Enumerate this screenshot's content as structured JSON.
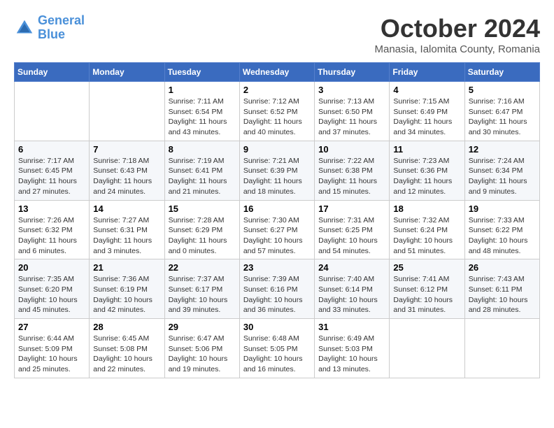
{
  "logo": {
    "line1": "General",
    "line2": "Blue"
  },
  "title": "October 2024",
  "location": "Manasia, Ialomita County, Romania",
  "weekdays": [
    "Sunday",
    "Monday",
    "Tuesday",
    "Wednesday",
    "Thursday",
    "Friday",
    "Saturday"
  ],
  "weeks": [
    [
      {
        "day": "",
        "sunrise": "",
        "sunset": "",
        "daylight": ""
      },
      {
        "day": "",
        "sunrise": "",
        "sunset": "",
        "daylight": ""
      },
      {
        "day": "1",
        "sunrise": "Sunrise: 7:11 AM",
        "sunset": "Sunset: 6:54 PM",
        "daylight": "Daylight: 11 hours and 43 minutes."
      },
      {
        "day": "2",
        "sunrise": "Sunrise: 7:12 AM",
        "sunset": "Sunset: 6:52 PM",
        "daylight": "Daylight: 11 hours and 40 minutes."
      },
      {
        "day": "3",
        "sunrise": "Sunrise: 7:13 AM",
        "sunset": "Sunset: 6:50 PM",
        "daylight": "Daylight: 11 hours and 37 minutes."
      },
      {
        "day": "4",
        "sunrise": "Sunrise: 7:15 AM",
        "sunset": "Sunset: 6:49 PM",
        "daylight": "Daylight: 11 hours and 34 minutes."
      },
      {
        "day": "5",
        "sunrise": "Sunrise: 7:16 AM",
        "sunset": "Sunset: 6:47 PM",
        "daylight": "Daylight: 11 hours and 30 minutes."
      }
    ],
    [
      {
        "day": "6",
        "sunrise": "Sunrise: 7:17 AM",
        "sunset": "Sunset: 6:45 PM",
        "daylight": "Daylight: 11 hours and 27 minutes."
      },
      {
        "day": "7",
        "sunrise": "Sunrise: 7:18 AM",
        "sunset": "Sunset: 6:43 PM",
        "daylight": "Daylight: 11 hours and 24 minutes."
      },
      {
        "day": "8",
        "sunrise": "Sunrise: 7:19 AM",
        "sunset": "Sunset: 6:41 PM",
        "daylight": "Daylight: 11 hours and 21 minutes."
      },
      {
        "day": "9",
        "sunrise": "Sunrise: 7:21 AM",
        "sunset": "Sunset: 6:39 PM",
        "daylight": "Daylight: 11 hours and 18 minutes."
      },
      {
        "day": "10",
        "sunrise": "Sunrise: 7:22 AM",
        "sunset": "Sunset: 6:38 PM",
        "daylight": "Daylight: 11 hours and 15 minutes."
      },
      {
        "day": "11",
        "sunrise": "Sunrise: 7:23 AM",
        "sunset": "Sunset: 6:36 PM",
        "daylight": "Daylight: 11 hours and 12 minutes."
      },
      {
        "day": "12",
        "sunrise": "Sunrise: 7:24 AM",
        "sunset": "Sunset: 6:34 PM",
        "daylight": "Daylight: 11 hours and 9 minutes."
      }
    ],
    [
      {
        "day": "13",
        "sunrise": "Sunrise: 7:26 AM",
        "sunset": "Sunset: 6:32 PM",
        "daylight": "Daylight: 11 hours and 6 minutes."
      },
      {
        "day": "14",
        "sunrise": "Sunrise: 7:27 AM",
        "sunset": "Sunset: 6:31 PM",
        "daylight": "Daylight: 11 hours and 3 minutes."
      },
      {
        "day": "15",
        "sunrise": "Sunrise: 7:28 AM",
        "sunset": "Sunset: 6:29 PM",
        "daylight": "Daylight: 11 hours and 0 minutes."
      },
      {
        "day": "16",
        "sunrise": "Sunrise: 7:30 AM",
        "sunset": "Sunset: 6:27 PM",
        "daylight": "Daylight: 10 hours and 57 minutes."
      },
      {
        "day": "17",
        "sunrise": "Sunrise: 7:31 AM",
        "sunset": "Sunset: 6:25 PM",
        "daylight": "Daylight: 10 hours and 54 minutes."
      },
      {
        "day": "18",
        "sunrise": "Sunrise: 7:32 AM",
        "sunset": "Sunset: 6:24 PM",
        "daylight": "Daylight: 10 hours and 51 minutes."
      },
      {
        "day": "19",
        "sunrise": "Sunrise: 7:33 AM",
        "sunset": "Sunset: 6:22 PM",
        "daylight": "Daylight: 10 hours and 48 minutes."
      }
    ],
    [
      {
        "day": "20",
        "sunrise": "Sunrise: 7:35 AM",
        "sunset": "Sunset: 6:20 PM",
        "daylight": "Daylight: 10 hours and 45 minutes."
      },
      {
        "day": "21",
        "sunrise": "Sunrise: 7:36 AM",
        "sunset": "Sunset: 6:19 PM",
        "daylight": "Daylight: 10 hours and 42 minutes."
      },
      {
        "day": "22",
        "sunrise": "Sunrise: 7:37 AM",
        "sunset": "Sunset: 6:17 PM",
        "daylight": "Daylight: 10 hours and 39 minutes."
      },
      {
        "day": "23",
        "sunrise": "Sunrise: 7:39 AM",
        "sunset": "Sunset: 6:16 PM",
        "daylight": "Daylight: 10 hours and 36 minutes."
      },
      {
        "day": "24",
        "sunrise": "Sunrise: 7:40 AM",
        "sunset": "Sunset: 6:14 PM",
        "daylight": "Daylight: 10 hours and 33 minutes."
      },
      {
        "day": "25",
        "sunrise": "Sunrise: 7:41 AM",
        "sunset": "Sunset: 6:12 PM",
        "daylight": "Daylight: 10 hours and 31 minutes."
      },
      {
        "day": "26",
        "sunrise": "Sunrise: 7:43 AM",
        "sunset": "Sunset: 6:11 PM",
        "daylight": "Daylight: 10 hours and 28 minutes."
      }
    ],
    [
      {
        "day": "27",
        "sunrise": "Sunrise: 6:44 AM",
        "sunset": "Sunset: 5:09 PM",
        "daylight": "Daylight: 10 hours and 25 minutes."
      },
      {
        "day": "28",
        "sunrise": "Sunrise: 6:45 AM",
        "sunset": "Sunset: 5:08 PM",
        "daylight": "Daylight: 10 hours and 22 minutes."
      },
      {
        "day": "29",
        "sunrise": "Sunrise: 6:47 AM",
        "sunset": "Sunset: 5:06 PM",
        "daylight": "Daylight: 10 hours and 19 minutes."
      },
      {
        "day": "30",
        "sunrise": "Sunrise: 6:48 AM",
        "sunset": "Sunset: 5:05 PM",
        "daylight": "Daylight: 10 hours and 16 minutes."
      },
      {
        "day": "31",
        "sunrise": "Sunrise: 6:49 AM",
        "sunset": "Sunset: 5:03 PM",
        "daylight": "Daylight: 10 hours and 13 minutes."
      },
      {
        "day": "",
        "sunrise": "",
        "sunset": "",
        "daylight": ""
      },
      {
        "day": "",
        "sunrise": "",
        "sunset": "",
        "daylight": ""
      }
    ]
  ]
}
